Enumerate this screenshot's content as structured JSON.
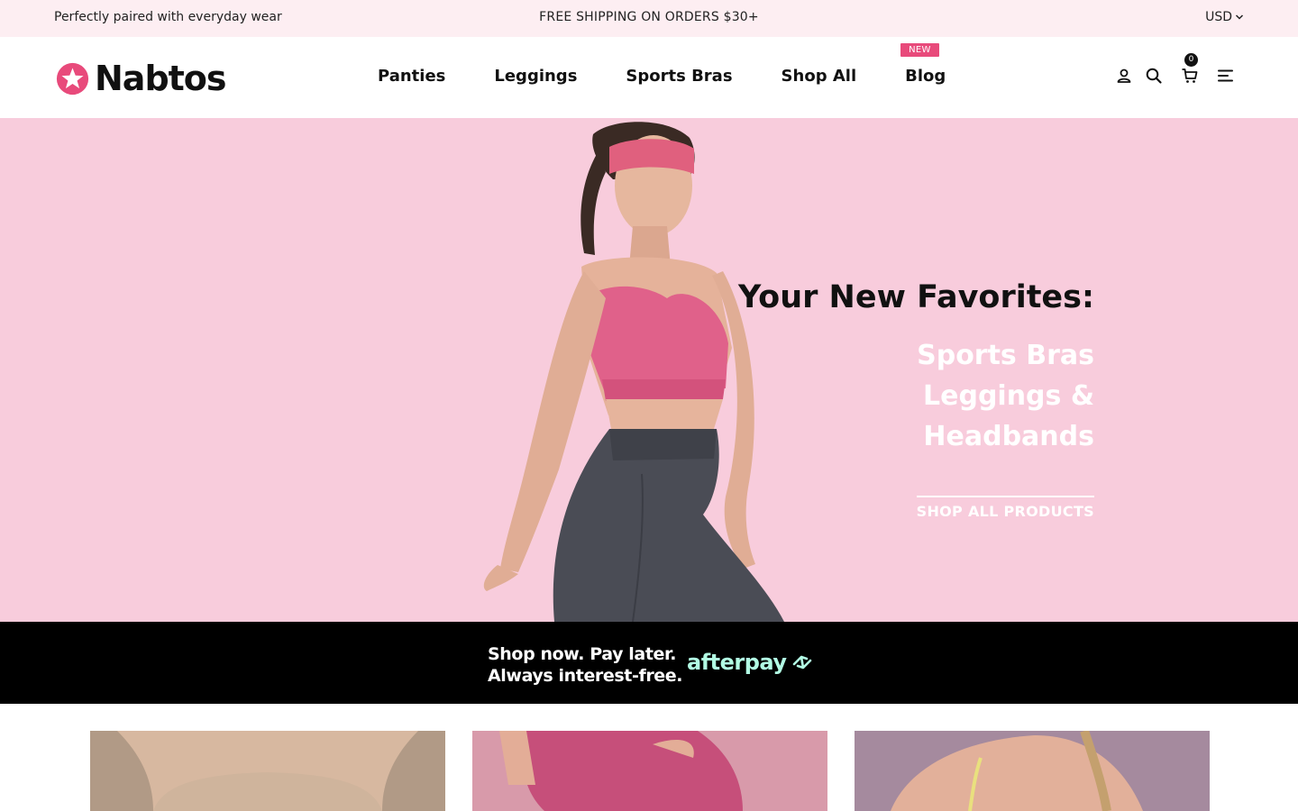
{
  "announcement": {
    "left": "Perfectly paired with everyday wear",
    "center": "FREE SHIPPING ON ORDERS $30+",
    "currency": "USD"
  },
  "header": {
    "logo": "Nabtos",
    "nav": [
      {
        "label": "Panties"
      },
      {
        "label": "Leggings"
      },
      {
        "label": "Sports Bras"
      },
      {
        "label": "Shop All"
      },
      {
        "label": "Blog",
        "badge": "NEW"
      }
    ],
    "cart_count": "0",
    "icons": [
      "user-icon",
      "search-icon",
      "cart-icon",
      "menu-icon"
    ]
  },
  "hero": {
    "title": "Your New Favorites:",
    "lines": [
      "Sports Bras",
      "Leggings &",
      "Headbands"
    ],
    "cta": "SHOP ALL PRODUCTS",
    "background": "#f8ccdc"
  },
  "afterpay": {
    "line1": "Shop now. Pay later.",
    "line2": "Always interest-free.",
    "brand": "afterpay",
    "brand_color": "#b2fce4"
  },
  "categories": [
    "panties",
    "leggings",
    "sports-bras"
  ],
  "colors": {
    "accent": "#e84a7b",
    "announcement_bg": "#fdeef2"
  }
}
